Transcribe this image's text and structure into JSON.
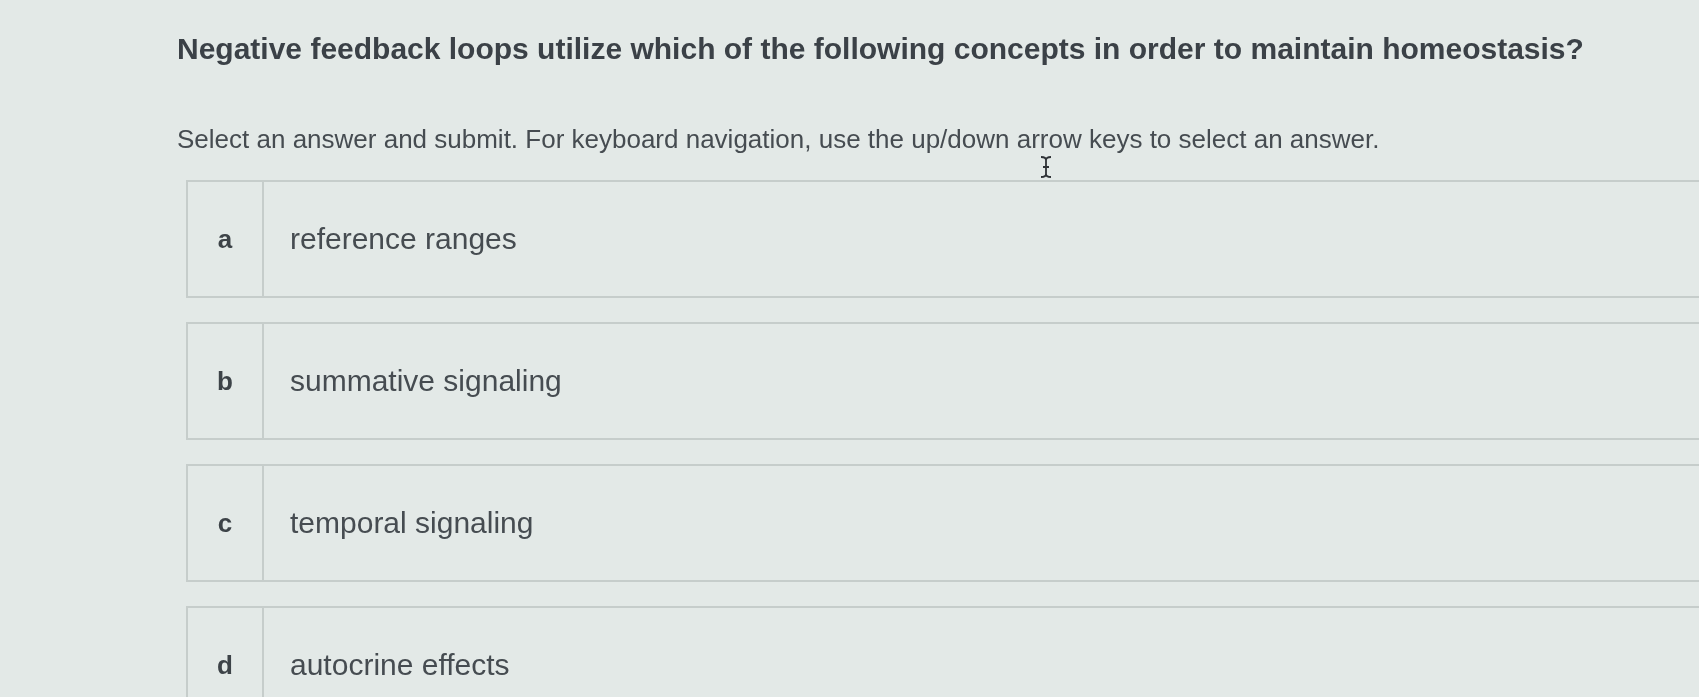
{
  "question": "Negative feedback loops utilize which of the following concepts in order to maintain homeostasis?",
  "instructions": "Select an answer and submit. For keyboard navigation, use the up/down arrow keys to select an answer.",
  "options": [
    {
      "letter": "a",
      "text": "reference ranges",
      "selected": false
    },
    {
      "letter": "b",
      "text": "summative signaling",
      "selected": false
    },
    {
      "letter": "c",
      "text": "temporal signaling",
      "selected": false
    },
    {
      "letter": "d",
      "text": "autocrine effects",
      "selected": false
    }
  ]
}
